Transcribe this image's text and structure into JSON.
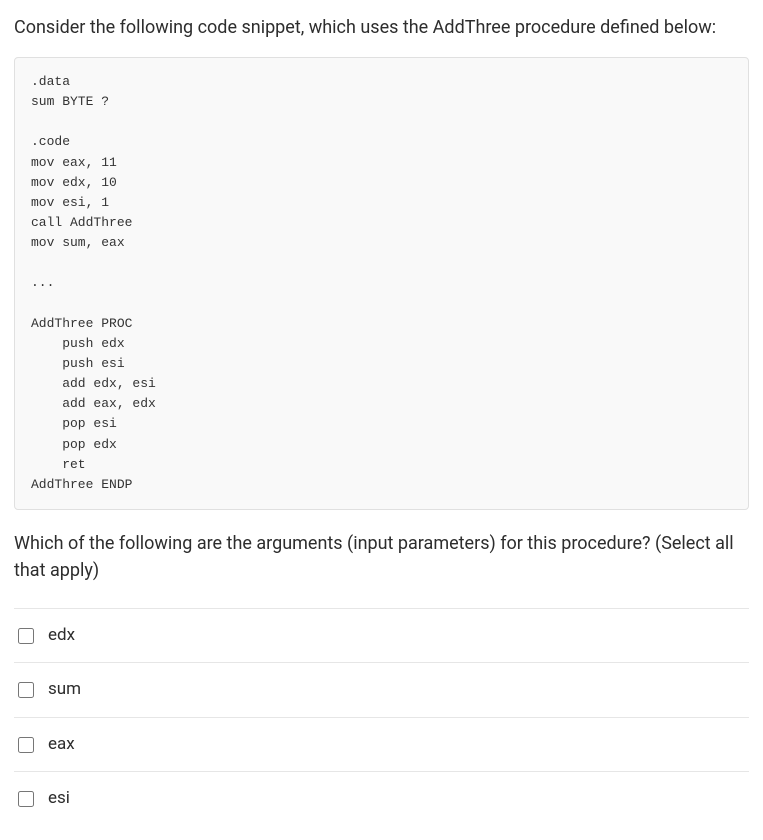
{
  "intro": "Consider the following code snippet, which uses the AddThree procedure defined below:",
  "code": ".data\nsum BYTE ?\n\n.code\nmov eax, 11\nmov edx, 10\nmov esi, 1\ncall AddThree\nmov sum, eax\n\n...\n\nAddThree PROC\n    push edx\n    push esi\n    add edx, esi\n    add eax, edx\n    pop esi\n    pop edx\n    ret\nAddThree ENDP",
  "prompt": "Which of the following are the arguments (input parameters) for this procedure? (Select all that apply)",
  "options": [
    {
      "label": "edx"
    },
    {
      "label": "sum"
    },
    {
      "label": "eax"
    },
    {
      "label": "esi"
    }
  ]
}
